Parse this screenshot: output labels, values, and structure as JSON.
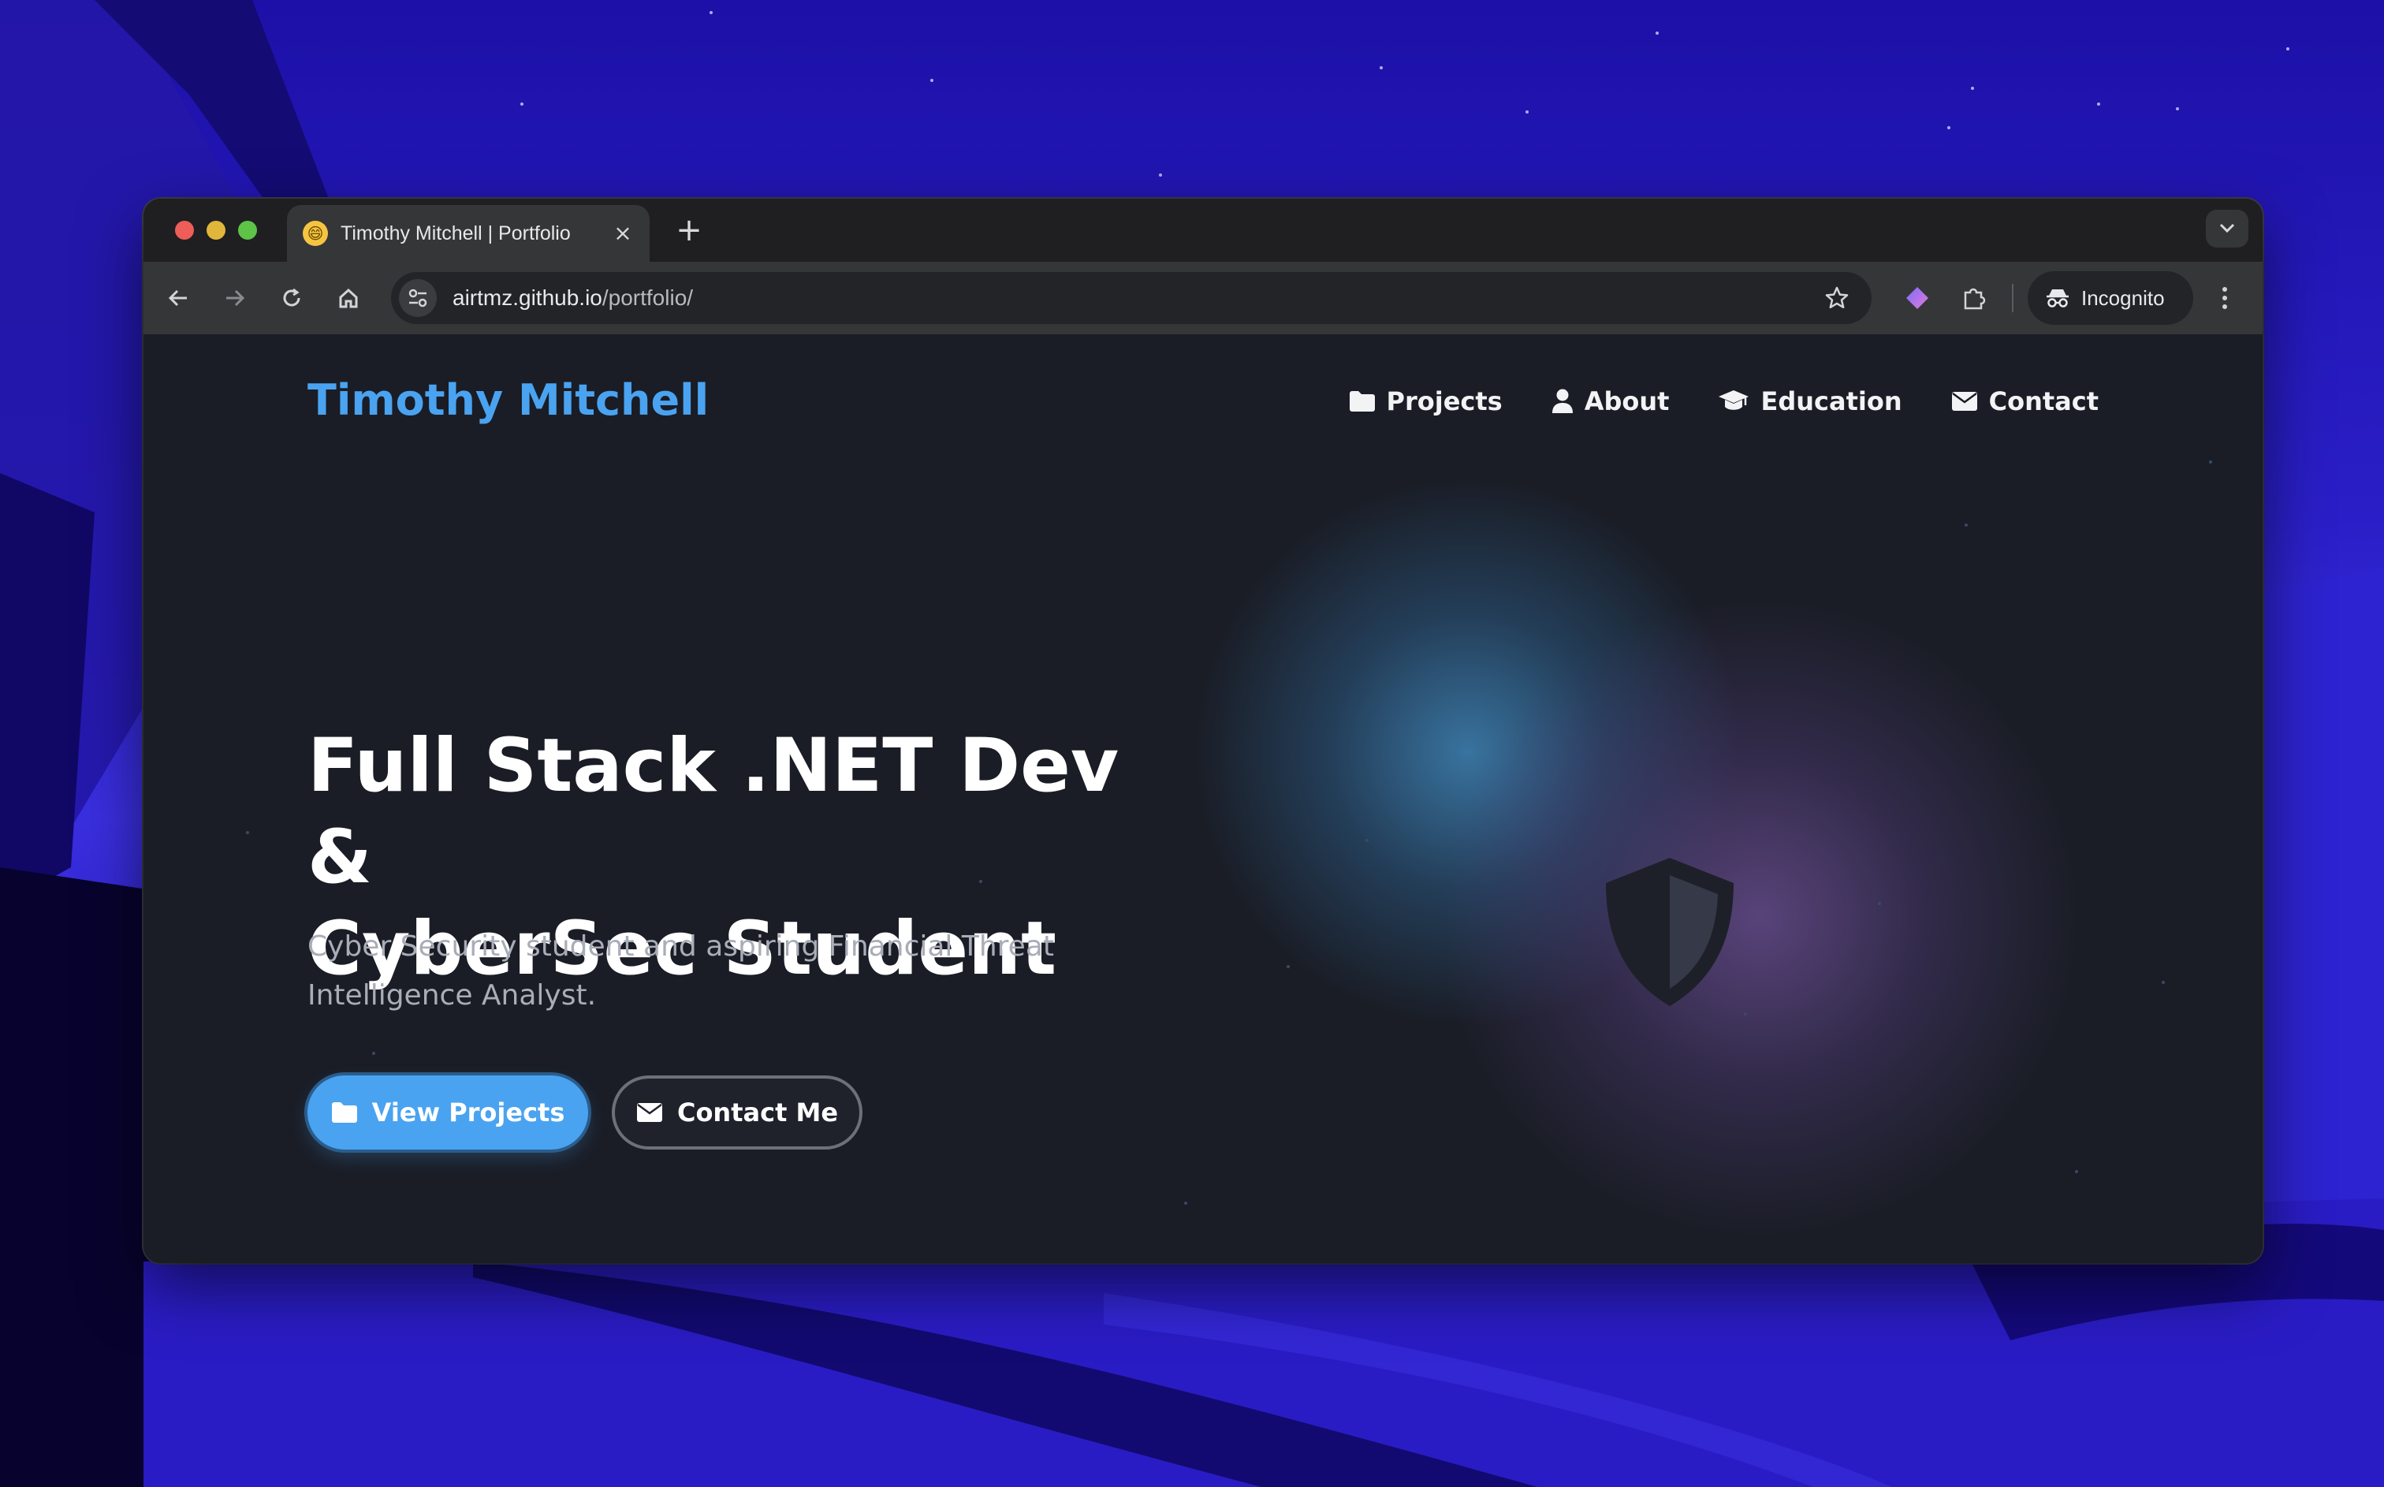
{
  "browser": {
    "tab": {
      "title": "Timothy Mitchell | Portfolio",
      "favicon": "😄"
    },
    "new_tab_label": "+",
    "url": {
      "host": "airtmz.github.io",
      "path": "/portfolio/"
    },
    "incognito_label": "Incognito"
  },
  "site": {
    "brand": "Timothy Mitchell",
    "nav": [
      {
        "label": "Projects",
        "icon": "folder-icon"
      },
      {
        "label": "About",
        "icon": "user-icon"
      },
      {
        "label": "Education",
        "icon": "graduation-cap-icon"
      },
      {
        "label": "Contact",
        "icon": "envelope-icon"
      }
    ],
    "hero": {
      "title_line1": "Full Stack .NET Dev &",
      "title_line2": "CyberSec Student",
      "subtitle_line1": "Cyber Security student and aspiring Financial Threat",
      "subtitle_line2": "Intelligence Analyst.",
      "primary_button": "View Projects",
      "secondary_button": "Contact Me"
    }
  },
  "colors": {
    "accent": "#4aa3f0",
    "page_bg": "#1a1d26",
    "text": "#ffffff",
    "muted": "#a9adb8"
  }
}
